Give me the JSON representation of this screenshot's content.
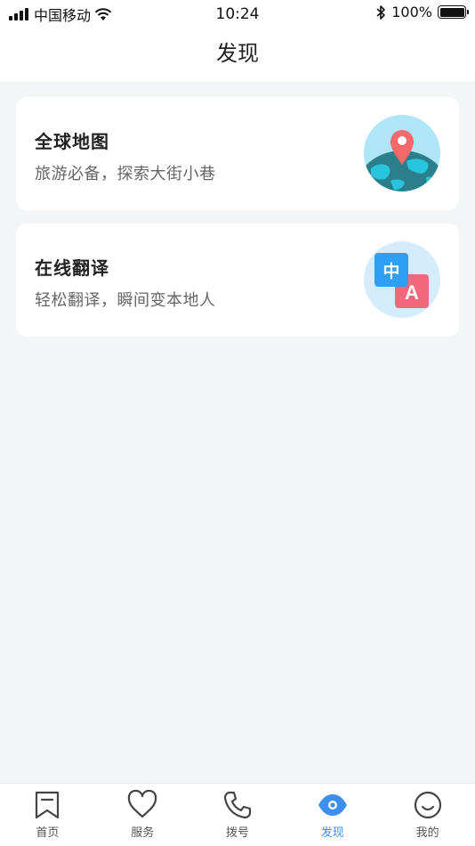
{
  "status_bar": {
    "carrier": "中国移动",
    "time": "10:24",
    "battery": "100%",
    "battery_level": 1.0,
    "icons": [
      "signal-icon",
      "wifi-icon",
      "bluetooth-icon",
      "battery-icon"
    ]
  },
  "nav": {
    "title": "发现"
  },
  "cards": [
    {
      "title": "全球地图",
      "subtitle": "旅游必备，探索大街小巷",
      "icon": "globe-map-pin-icon"
    },
    {
      "title": "在线翻译",
      "subtitle": "轻松翻译，瞬间变本地人",
      "icon": "translate-icon",
      "badge_cn": "中",
      "badge_en": "A"
    }
  ],
  "tabs": [
    {
      "label": "首页",
      "icon": "bookmark-icon",
      "active": false
    },
    {
      "label": "服务",
      "icon": "heart-icon",
      "active": false
    },
    {
      "label": "拨号",
      "icon": "phone-icon",
      "active": false
    },
    {
      "label": "发现",
      "icon": "eye-icon",
      "active": true
    },
    {
      "label": "我的",
      "icon": "smile-icon",
      "active": false
    }
  ],
  "colors": {
    "accent": "#3d8ef0",
    "background": "#f4f5f7",
    "card": "#ffffff"
  }
}
